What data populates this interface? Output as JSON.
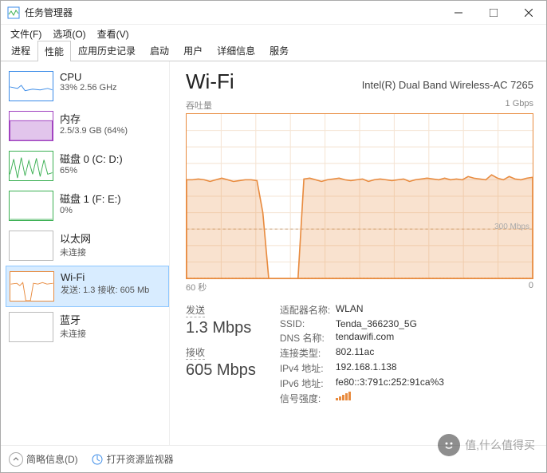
{
  "window": {
    "title": "任务管理器"
  },
  "menus": {
    "file": "文件(F)",
    "options": "选项(O)",
    "view": "查看(V)"
  },
  "tabs": [
    "进程",
    "性能",
    "应用历史记录",
    "启动",
    "用户",
    "详细信息",
    "服务"
  ],
  "active_tab": 1,
  "sidebar": [
    {
      "name": "CPU",
      "sub": "33% 2.56 GHz",
      "color": "#3a8be8"
    },
    {
      "name": "内存",
      "sub": "2.5/3.9 GB (64%)",
      "color": "#a040c0"
    },
    {
      "name": "磁盘 0 (C: D:)",
      "sub": "65%",
      "color": "#3bb053"
    },
    {
      "name": "磁盘 1 (F: E:)",
      "sub": "0%",
      "color": "#3bb053"
    },
    {
      "name": "以太网",
      "sub": "未连接",
      "color": "#bbb"
    },
    {
      "name": "Wi-Fi",
      "sub": "发送: 1.3 接收: 605 Mb",
      "color": "#e88b3f",
      "selected": true
    },
    {
      "name": "蓝牙",
      "sub": "未连接",
      "color": "#bbb"
    }
  ],
  "main": {
    "title": "Wi-Fi",
    "adapter": "Intel(R) Dual Band Wireless-AC 7265",
    "chart_top_left": "吞吐量",
    "chart_top_right": "1 Gbps",
    "chart_dash_label": "300 Mbps",
    "x_left": "60 秒",
    "x_right": "0",
    "send_label": "发送",
    "send_value": "1.3 Mbps",
    "recv_label": "接收",
    "recv_value": "605 Mbps",
    "props": {
      "adapter_name_k": "适配器名称:",
      "adapter_name_v": "WLAN",
      "ssid_k": "SSID:",
      "ssid_v": "Tenda_366230_5G",
      "dns_k": "DNS 名称:",
      "dns_v": "tendawifi.com",
      "type_k": "连接类型:",
      "type_v": "802.11ac",
      "ipv4_k": "IPv4 地址:",
      "ipv4_v": "192.168.1.138",
      "ipv6_k": "IPv6 地址:",
      "ipv6_v": "fe80::3:791c:252:91ca%3",
      "sig_k": "信号强度:"
    }
  },
  "footer": {
    "brief": "简略信息(D)",
    "resmon": "打开资源监视器"
  },
  "watermark": "值,什么值得买",
  "chart_data": {
    "type": "area",
    "xlabel": "60 秒 → 0",
    "ylabel": "吞吐量",
    "ylim": [
      0,
      1000
    ],
    "yunit": "Mbps",
    "ref_line": 300,
    "series": [
      {
        "name": "接收",
        "color": "#e88b3f",
        "values": [
          600,
          600,
          605,
          600,
          590,
          600,
          610,
          600,
          590,
          595,
          600,
          600,
          595,
          400,
          0,
          0,
          0,
          0,
          0,
          0,
          605,
          610,
          600,
          590,
          600,
          605,
          610,
          600,
          595,
          600,
          605,
          590,
          600,
          605,
          600,
          595,
          600,
          605,
          590,
          600,
          605,
          610,
          605,
          600,
          610,
          600,
          605,
          600,
          620,
          610,
          605,
          600,
          630,
          610,
          600,
          620,
          605,
          600,
          610,
          615
        ]
      },
      {
        "name": "发送",
        "color": "#e88b3f",
        "dashed": true,
        "values": [
          1.3,
          1.3,
          1.3,
          1.3,
          1.3,
          1.3,
          1.3,
          1.3,
          1.3,
          1.3,
          1.3,
          1.3,
          1.3,
          1.0,
          0,
          0,
          0,
          0,
          0,
          0,
          1.2,
          1.3,
          1.3,
          1.3,
          1.3,
          1.3,
          1.3,
          1.3,
          1.3,
          1.3,
          1.3,
          1.3,
          1.3,
          1.3,
          1.3,
          1.3,
          1.3,
          1.3,
          1.3,
          1.3,
          1.3,
          1.3,
          1.3,
          1.3,
          1.3,
          1.3,
          1.3,
          1.3,
          1.3,
          1.3,
          1.3,
          1.3,
          1.3,
          1.3,
          1.3,
          1.3,
          1.3,
          1.3,
          1.3,
          1.3
        ]
      }
    ]
  }
}
